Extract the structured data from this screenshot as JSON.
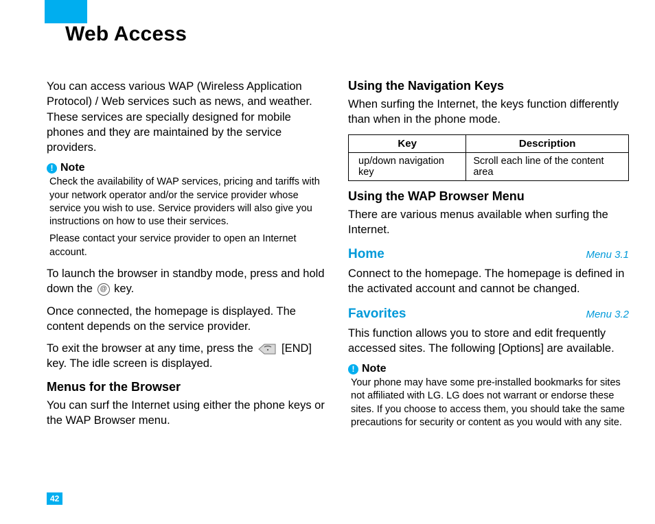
{
  "page": {
    "title": "Web Access",
    "number": "42"
  },
  "left": {
    "intro": "You can access various WAP (Wireless Application Protocol) / Web services such as news, and weather. These services are specially designed for mobile phones and they are maintained by the service providers.",
    "note_label": "Note",
    "note_p1": "Check the availability of WAP services, pricing and tariffs with your network operator and/or the service provider whose service you wish to use. Service providers will also give you instructions on how to use their services.",
    "note_p2": "Please contact your service provider to open an Internet account.",
    "launch_pre": "To launch the browser in standby mode, press and hold down the ",
    "launch_post": " key.",
    "connected": "Once connected, the homepage is displayed. The content depends on the service provider.",
    "exit_pre": "To exit the browser at any time, press the ",
    "exit_post": " [END] key. The idle screen is displayed.",
    "menus_head": "Menus for the Browser",
    "menus_body": "You can surf the Internet using either the phone keys or the WAP Browser menu."
  },
  "right": {
    "nav_head": "Using the Navigation Keys",
    "nav_body": "When surfing the Internet, the keys function differently than when in the phone mode.",
    "table": {
      "h1": "Key",
      "h2": "Description",
      "r1c1": "up/down navigation key",
      "r1c2": "Scroll each line of the content area"
    },
    "wap_head": "Using the WAP Browser Menu",
    "wap_body": "There are various menus available when surfing the Internet.",
    "home": {
      "name": "Home",
      "ref": "Menu 3.1",
      "body": "Connect to the homepage. The homepage is defined in the activated account and cannot be changed."
    },
    "fav": {
      "name": "Favorites",
      "ref": "Menu 3.2",
      "body": "This function allows you to store and edit frequently accessed sites.  The following [Options] are available."
    },
    "note_label": "Note",
    "note_body": "Your phone may have some pre-installed bookmarks for sites not affiliated with LG. LG does not warrant or endorse these sites. If you choose to access them, you should take the same precautions for security or content as you would with any site."
  },
  "icons": {
    "browser_key_glyph": "@"
  }
}
